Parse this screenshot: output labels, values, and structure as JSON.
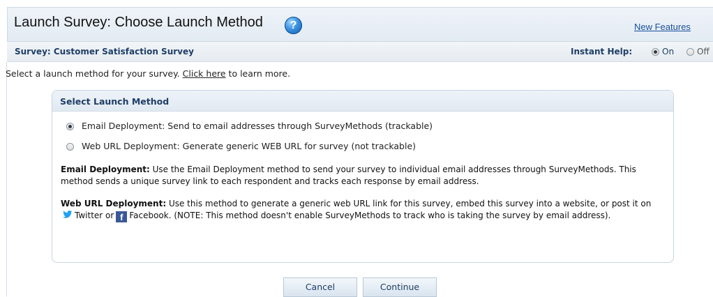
{
  "header": {
    "title": "Launch Survey: Choose Launch Method",
    "help_icon": "?",
    "new_features_link": "New Features"
  },
  "subheader": {
    "survey_label": "Survey: Customer Satisfaction Survey",
    "instant_help_label": "Instant Help:",
    "instant_help_on": "On",
    "instant_help_off": "Off",
    "instant_help_selected": "On"
  },
  "intro": {
    "before": "Select a launch method for your survey. ",
    "link": "Click here",
    "after": " to learn more."
  },
  "launch_panel": {
    "title": "Select Launch Method",
    "options": [
      {
        "label": "Email Deployment: Send to email addresses through SurveyMethods (trackable)",
        "selected": true
      },
      {
        "label": "Web URL Deployment: Generate generic WEB URL for survey (not trackable)",
        "selected": false
      }
    ],
    "email_desc": {
      "heading": "Email Deployment:",
      "text": " Use the Email Deployment method to send your survey to individual email addresses through SurveyMethods. This method sends a unique survey link to each respondent and tracks each response by email address."
    },
    "web_desc": {
      "heading": "Web URL Deployment:",
      "text1": " Use this method to generate a generic web URL link for this survey, embed this survey into a website, or post it on ",
      "twitter": "Twitter or",
      "facebook": "Facebook. (NOTE: This method doesn't enable SurveyMethods to track who is taking the survey by email address)."
    }
  },
  "buttons": {
    "cancel": "Cancel",
    "continue": "Continue"
  },
  "colors": {
    "accent": "#1f3e66",
    "link": "#1a4f9c",
    "facebook": "#3b5998",
    "twitter": "#1da1f2"
  }
}
